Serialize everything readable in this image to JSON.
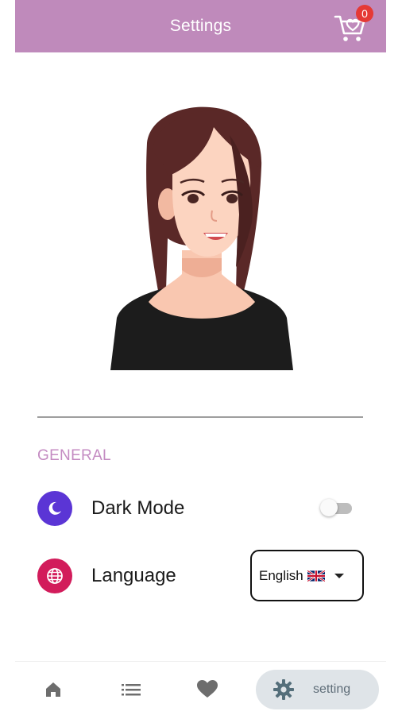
{
  "app_bar": {
    "title": "Settings",
    "cart_count": "0",
    "color": "#bf8abb"
  },
  "profile": {
    "avatar_icon": "woman-avatar-illustration"
  },
  "general": {
    "section_label": "GENERAL",
    "dark_mode": {
      "label": "Dark Mode",
      "icon": "moon-icon",
      "enabled": false,
      "icon_color": "#5b35d5"
    },
    "language": {
      "label": "Language",
      "icon": "globe-icon",
      "selected": "English",
      "flag": "uk-flag-icon",
      "icon_color": "#d21c5b"
    }
  },
  "bottom_nav": {
    "items": [
      {
        "icon": "home-icon"
      },
      {
        "icon": "list-icon"
      },
      {
        "icon": "heart-icon"
      },
      {
        "icon": "gear-icon",
        "label": "setting",
        "active": true
      }
    ]
  }
}
